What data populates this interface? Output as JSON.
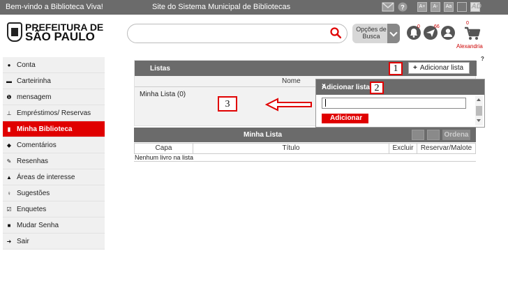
{
  "topbar": {
    "welcome": "Bem-vindo a Biblioteca Viva!",
    "site": "Site do Sistema Municipal de Bibliotecas",
    "font_buttons": [
      "A+",
      "A-",
      "Aa"
    ],
    "ad_label": "AD"
  },
  "logo": {
    "line1": "PREFEITURA DE",
    "line2": "SÃO PAULO"
  },
  "search": {
    "value": "",
    "placeholder": "",
    "options_label": "Opções de Busca"
  },
  "header": {
    "notif_count": "0",
    "messages_count": "66",
    "cart_count": "0",
    "user_name": "Alexandria"
  },
  "sidebar": {
    "items": [
      {
        "label": "Conta",
        "icon": "user-icon"
      },
      {
        "label": "Carteirinha",
        "icon": "card-icon"
      },
      {
        "label": "mensagem",
        "icon": "info-icon"
      },
      {
        "label": "Empréstimos/ Reservas",
        "icon": "pin-icon"
      },
      {
        "label": "Minha Biblioteca",
        "icon": "book-icon",
        "active": true
      },
      {
        "label": "Comentários",
        "icon": "comment-icon"
      },
      {
        "label": "Resenhas",
        "icon": "pencil-icon"
      },
      {
        "label": "Áreas de interesse",
        "icon": "thumbs-up-icon"
      },
      {
        "label": "Sugestões",
        "icon": "bulb-icon"
      },
      {
        "label": "Enquetes",
        "icon": "edit-icon"
      },
      {
        "label": "Mudar Senha",
        "icon": "lock-icon"
      },
      {
        "label": "Sair",
        "icon": "logout-icon"
      }
    ]
  },
  "listas": {
    "title": "Listas",
    "add_label": "Adicionar lista",
    "column_nome": "Nome",
    "rows": [
      "Minha Lista (0)"
    ]
  },
  "modal": {
    "title": "Adicionar lista",
    "input_value": "",
    "button_label": "Adicionar",
    "close": "×"
  },
  "markers": [
    "1",
    "2",
    "3"
  ],
  "help": "?",
  "minha_lista": {
    "title": "Minha Lista",
    "ordena_label": "Ordena",
    "columns": [
      "Capa",
      "Título",
      "Excluir",
      "Reservar/Malote"
    ],
    "empty": "Nenhum livro na lista"
  },
  "colors": {
    "accent": "#e00000",
    "header_gray": "#6b6b6b"
  }
}
